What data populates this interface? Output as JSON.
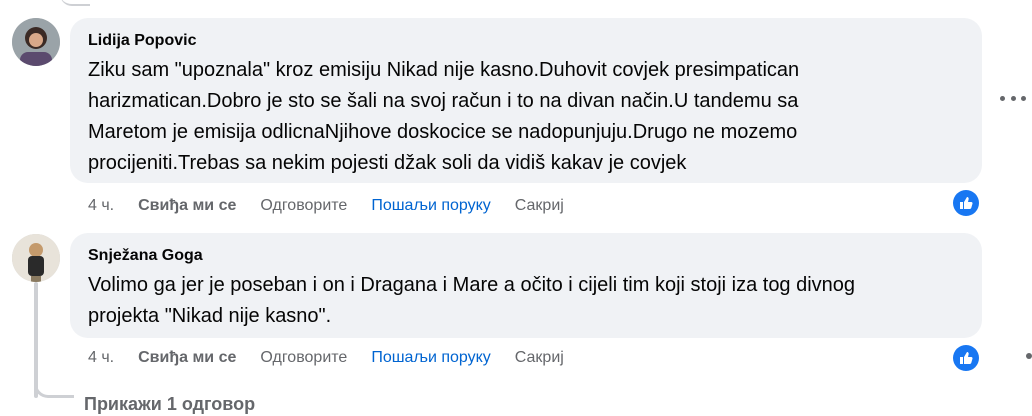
{
  "comments": [
    {
      "author": "Lidija Popovic",
      "text": "Ziku sam \"upoznala\" kroz emisiju Nikad nije kasno.Duhovit covjek presimpatican\nharizmatican.Dobro je sto se šali na svoj račun i to na divan način.U tandemu sa\nMaretom je emisija odlicnaNjihove doskocice se nadopunjuju.Drugo ne mozemo\nprocijeniti.Trebas sa nekim pojesti džak soli da vidiš kakav je covjek",
      "time": "4 ч.",
      "like_label": "Свиђа ми се",
      "reply_label": "Одговорите",
      "message_label": "Пошаљи поруку",
      "hide_label": "Сакриј",
      "reaction_icon": "thumbs-up-icon"
    },
    {
      "author": "Snježana Goga",
      "text": "Volimo ga jer je poseban i on i Dragana i Mare a očito i cijeli tim koji stoji iza tog divnog\nprojekta \"Nikad nije kasno\".",
      "time": "4 ч.",
      "like_label": "Свиђа ми се",
      "reply_label": "Одговорите",
      "message_label": "Пошаљи поруку",
      "hide_label": "Сакриј",
      "reaction_icon": "thumbs-up-icon"
    }
  ],
  "view_replies_label": "Прикажи 1 одговор",
  "more_options_icon": "more-horizontal-icon",
  "colors": {
    "bubble": "#f0f2f5",
    "link": "#0064d1",
    "meta": "#65676b",
    "like_badge": "#1877f2"
  }
}
